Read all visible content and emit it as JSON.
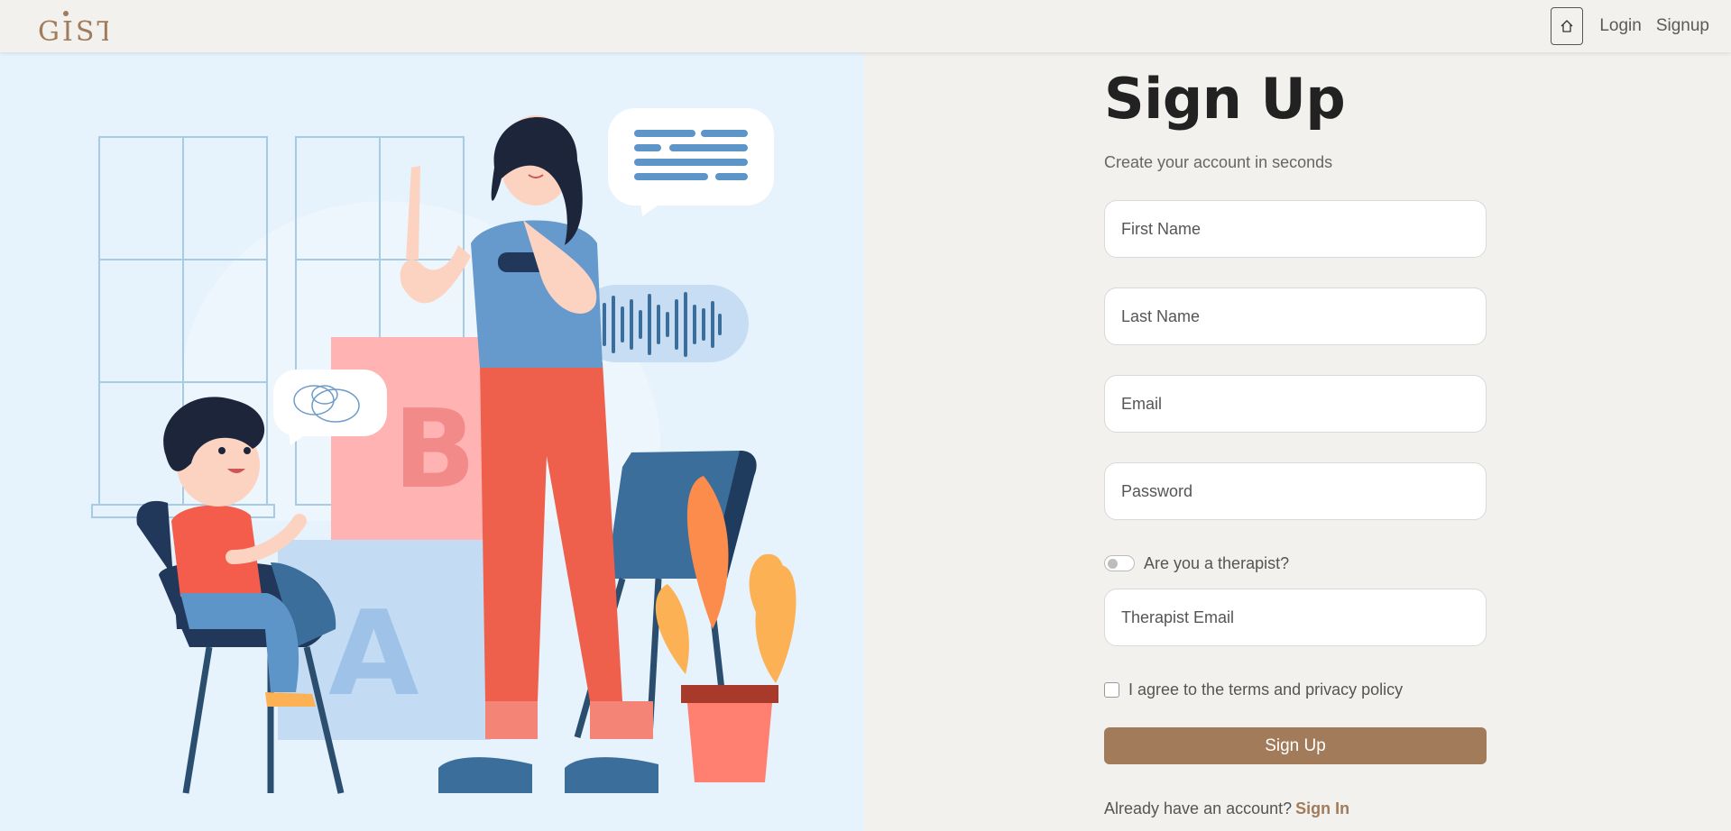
{
  "nav": {
    "brand": "GIST",
    "links": [
      "Login",
      "Signup"
    ],
    "home_icon": "home-icon"
  },
  "form": {
    "title": "Sign Up",
    "subtitle": "Create your account in seconds",
    "fields": {
      "first_name": "First Name",
      "last_name": "Last Name",
      "email": "Email",
      "password": "Password",
      "therapist_email": "Therapist Email"
    },
    "therapist_toggle_label": "Are you a therapist?",
    "terms_label": "I agree to the terms and privacy policy",
    "submit_label": "Sign Up",
    "footer_text": "Already have an account?",
    "footer_link": "Sign In"
  },
  "colors": {
    "background": "#f2f1ed",
    "accent": "#a17b5a",
    "illustration_bg": "#e6f2fc"
  }
}
